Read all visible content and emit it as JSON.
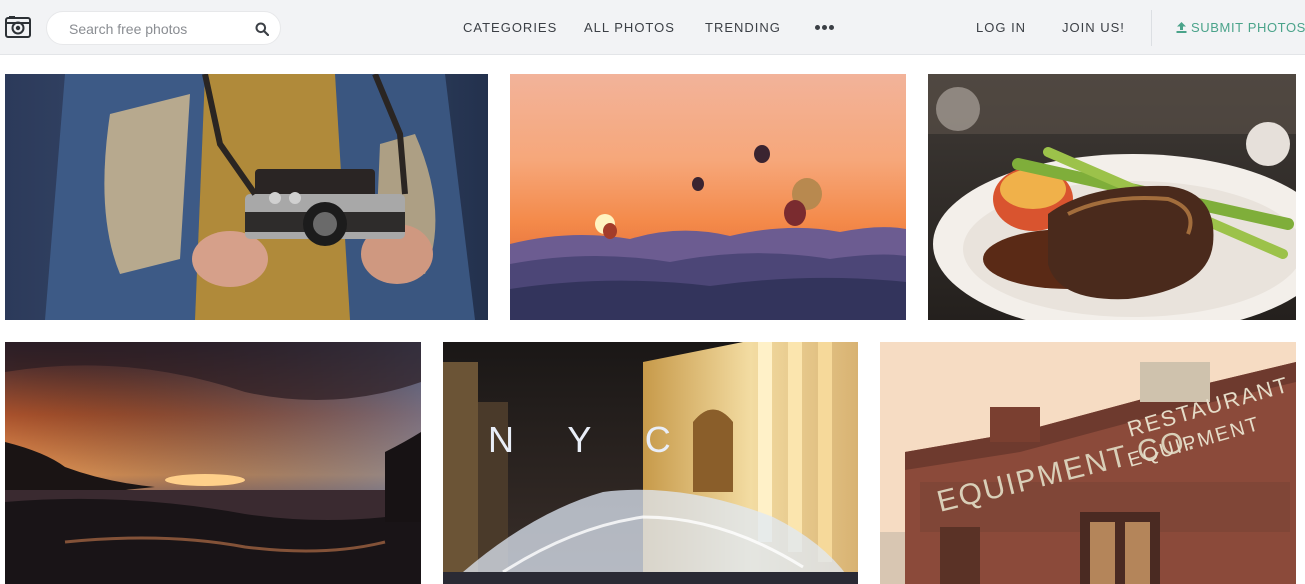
{
  "header": {
    "search": {
      "placeholder": "Search free photos"
    },
    "nav": {
      "categories": "CATEGORIES",
      "all_photos": "ALL PHOTOS",
      "trending": "TRENDING"
    },
    "login": "LOG IN",
    "join": "JOIN US!",
    "submit": "SUBMIT PHOTOS"
  },
  "colors": {
    "header_bg": "#f2f3f5",
    "accent": "#4aa38a",
    "nav_text": "#3b3f45"
  },
  "icons": {
    "logo": "camera-logo-icon",
    "search": "search-icon",
    "more": "more-dots-icon",
    "submit": "upload-icon"
  },
  "photos": [
    {
      "subject": "hands holding a camera"
    },
    {
      "subject": "hot air balloons at sunset"
    },
    {
      "subject": "steak with asparagus"
    },
    {
      "subject": "dramatic sunset over sea"
    },
    {
      "subject": "NYC fountain at night",
      "text": "N Y C"
    },
    {
      "subject": "brick building with painted sign",
      "text_line1": "RESTAURANT",
      "text_line2": "EQUIPMENT CO.",
      "text_line3": "EQUIPMENT"
    }
  ]
}
